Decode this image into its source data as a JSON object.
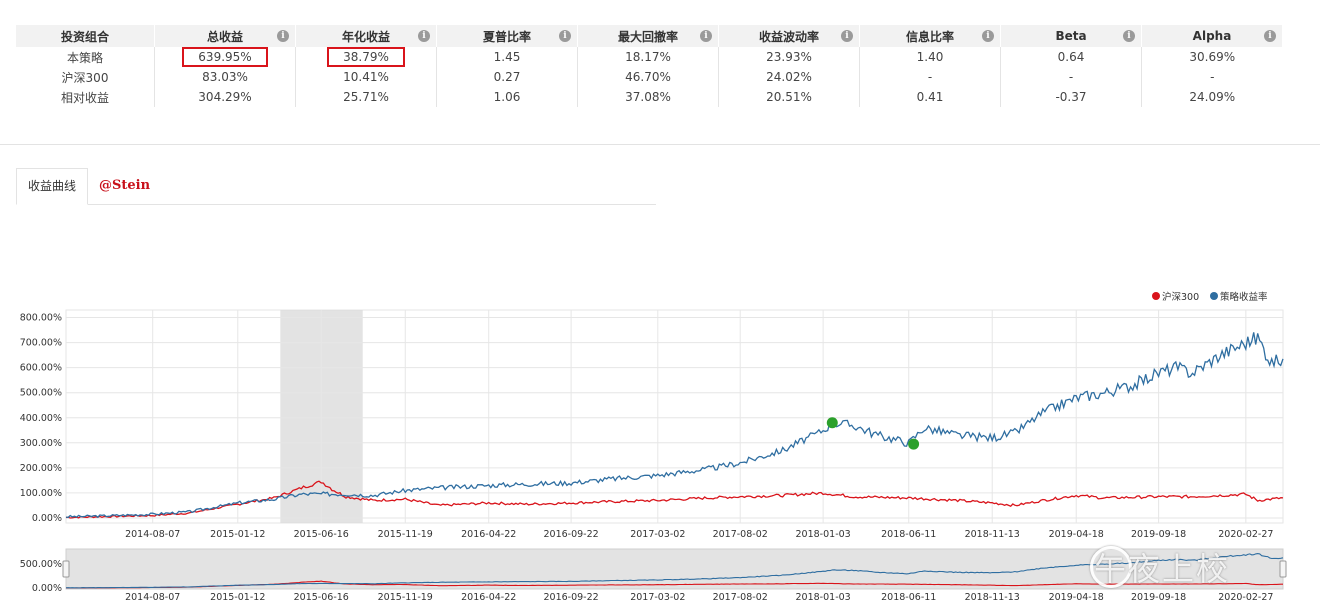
{
  "table": {
    "headers": [
      "投资组合",
      "总收益",
      "年化收益",
      "夏普比率",
      "最大回撤率",
      "收益波动率",
      "信息比率",
      "Beta",
      "Alpha"
    ],
    "rows": [
      [
        "本策略",
        "639.95%",
        "38.79%",
        "1.45",
        "18.17%",
        "23.93%",
        "1.40",
        "0.64",
        "30.69%"
      ],
      [
        "沪深300",
        "83.03%",
        "10.41%",
        "0.27",
        "46.70%",
        "24.02%",
        "-",
        "-",
        "-"
      ],
      [
        "相对收益",
        "304.29%",
        "25.71%",
        "1.06",
        "37.08%",
        "20.51%",
        "0.41",
        "-0.37",
        "24.09%"
      ]
    ],
    "info_icon_glyph": "i"
  },
  "tabs": {
    "active": "收益曲线",
    "author": "@Stein"
  },
  "watermark": "午夜上校",
  "colors": {
    "strategy": "#2f6ea1",
    "benchmark": "#d9141b",
    "marker": "#2ba02b",
    "highlight": "#d9141b"
  },
  "chart_data": {
    "type": "line",
    "xlabel": "",
    "ylabel": "",
    "yticks": [
      "0.00%",
      "100.00%",
      "200.00%",
      "300.00%",
      "400.00%",
      "500.00%",
      "600.00%",
      "700.00%",
      "800.00%"
    ],
    "ylim": [
      -20,
      830
    ],
    "xticks": [
      "2014-08-07",
      "2015-01-12",
      "2015-06-16",
      "2015-11-19",
      "2016-04-22",
      "2016-09-22",
      "2017-03-02",
      "2017-08-02",
      "2018-01-03",
      "2018-06-11",
      "2018-11-13",
      "2019-04-18",
      "2019-09-18",
      "2020-02-27"
    ],
    "x_range": [
      "2014-02-27",
      "2020-05-06"
    ],
    "legend": [
      "沪深300",
      "策略收益率"
    ],
    "legend_position": "top-right",
    "grid": true,
    "series": [
      {
        "name": "策略收益率",
        "color": "#2f6ea1",
        "x": [
          "2014-02-27",
          "2014-05-01",
          "2014-08-07",
          "2014-10-15",
          "2015-01-12",
          "2015-03-20",
          "2015-05-10",
          "2015-06-16",
          "2015-08-01",
          "2015-09-20",
          "2015-11-19",
          "2016-01-20",
          "2016-04-22",
          "2016-07-01",
          "2016-09-22",
          "2016-12-01",
          "2017-03-02",
          "2017-06-01",
          "2017-08-02",
          "2017-10-20",
          "2018-01-03",
          "2018-01-20",
          "2018-03-01",
          "2018-04-15",
          "2018-06-11",
          "2018-07-10",
          "2018-09-10",
          "2018-11-13",
          "2018-12-25",
          "2019-02-15",
          "2019-04-18",
          "2019-06-10",
          "2019-08-01",
          "2019-09-18",
          "2019-10-20",
          "2019-11-20",
          "2020-01-10",
          "2020-02-27",
          "2020-03-20",
          "2020-04-15",
          "2020-05-06"
        ],
        "values": [
          5,
          8,
          15,
          25,
          60,
          75,
          95,
          96,
          95,
          90,
          110,
          120,
          130,
          135,
          140,
          155,
          170,
          195,
          220,
          270,
          350,
          380,
          370,
          330,
          300,
          360,
          330,
          320,
          340,
          420,
          480,
          500,
          530,
          580,
          600,
          580,
          650,
          700,
          720,
          620,
          635
        ]
      },
      {
        "name": "沪深300",
        "color": "#d9141b",
        "x": [
          "2014-02-27",
          "2014-05-01",
          "2014-08-07",
          "2014-10-15",
          "2015-01-12",
          "2015-03-20",
          "2015-05-10",
          "2015-06-16",
          "2015-07-10",
          "2015-08-01",
          "2015-09-20",
          "2015-11-19",
          "2016-01-20",
          "2016-04-22",
          "2016-07-01",
          "2016-09-22",
          "2016-12-01",
          "2017-03-02",
          "2017-06-01",
          "2017-08-02",
          "2017-10-20",
          "2018-01-03",
          "2018-01-20",
          "2018-03-01",
          "2018-06-11",
          "2018-09-10",
          "2018-11-13",
          "2018-12-25",
          "2019-02-15",
          "2019-04-18",
          "2019-06-10",
          "2019-09-18",
          "2019-11-20",
          "2020-01-10",
          "2020-02-27",
          "2020-03-20",
          "2020-05-06"
        ],
        "values": [
          2,
          5,
          10,
          20,
          55,
          80,
          120,
          145,
          110,
          85,
          70,
          75,
          50,
          60,
          55,
          60,
          65,
          70,
          80,
          85,
          90,
          100,
          95,
          85,
          80,
          70,
          60,
          50,
          70,
          90,
          80,
          85,
          85,
          90,
          95,
          70,
          80
        ]
      }
    ],
    "markers": [
      {
        "x": "2018-01-20",
        "y": 380
      },
      {
        "x": "2018-06-20",
        "y": 295
      }
    ],
    "shaded_range": [
      "2015-04-01",
      "2015-09-01"
    ],
    "navigator": {
      "yticks": [
        "0.00%",
        "500.00%"
      ]
    }
  }
}
